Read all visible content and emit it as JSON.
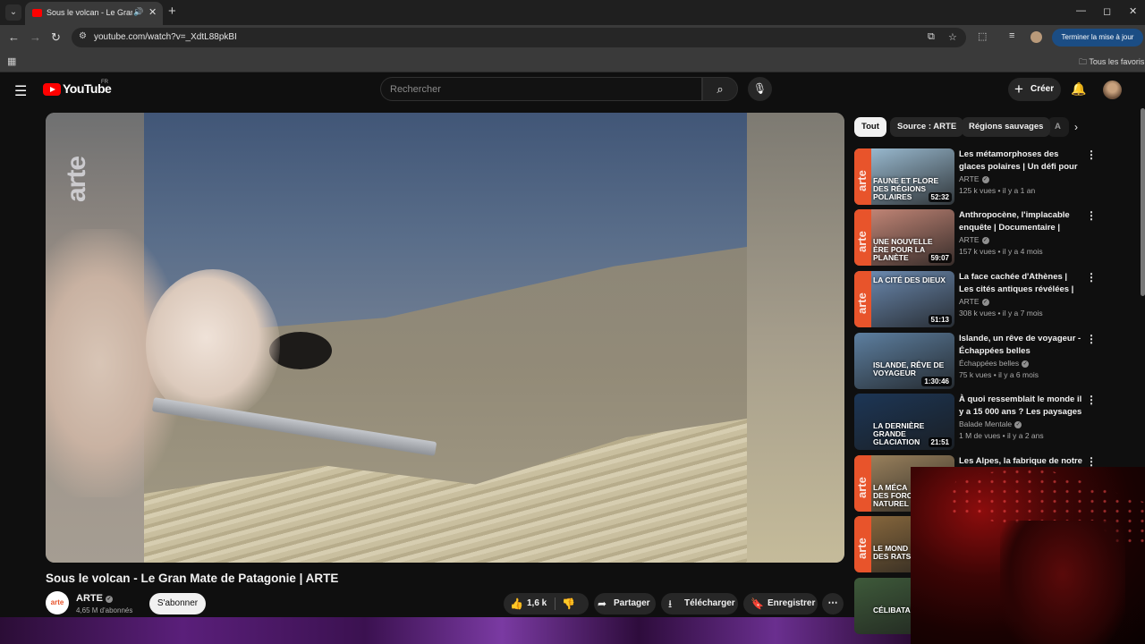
{
  "browser": {
    "tab_title": "Sous le volcan - Le Gran Mate",
    "new_tab": "+",
    "url": "youtube.com/watch?v=_XdtL88pkBI",
    "update_button": "Terminer la mise à jour",
    "bookmarks_folder": "Tous les favoris",
    "window_min": "—",
    "window_max": "◻",
    "window_close": "✕"
  },
  "header": {
    "logo": "YouTube",
    "country": "FR",
    "search_placeholder": "Rechercher",
    "create_label": "Créer"
  },
  "video": {
    "watermark": "arte",
    "title": "Sous le volcan - Le Gran Mate de Patagonie | ARTE",
    "channel": "ARTE",
    "channel_avatar_text": "arte",
    "subscribers": "4,65 M d'abonnés",
    "subscribe_label": "S'abonner",
    "likes": "1,6 k",
    "share_label": "Partager",
    "download_label": "Télécharger",
    "save_label": "Enregistrer"
  },
  "chips": [
    {
      "label": "Tout",
      "active": true
    },
    {
      "label": "Source : ARTE"
    },
    {
      "label": "Régions sauvages"
    },
    {
      "label": "A"
    }
  ],
  "sidebar": {
    "items": [
      {
        "title": "Les métamorphoses des glaces polaires | Un défi pour les ...",
        "channel": "ARTE",
        "meta": "125 k vues • il y a 1 an",
        "duration": "52:32",
        "caption": "FAUNE ET FLORE DES RÉGIONS POLAIRES",
        "thumb_bg": "#9fc1d8"
      },
      {
        "title": "Anthropocène, l'implacable enquête | Documentaire | ARTE",
        "channel": "ARTE",
        "meta": "157 k vues • il y a 4 mois",
        "duration": "59:07",
        "caption": "UNE NOUVELLE ÈRE POUR LA PLANÈTE",
        "thumb_bg": "#c98a7a"
      },
      {
        "title": "La face cachée d'Athènes | Les cités antiques révélées | ARTE",
        "channel": "ARTE",
        "meta": "308 k vues • il y a 7 mois",
        "duration": "51:13",
        "caption": "LA CITÉ DES DIEUX",
        "thumb_bg": "#6f8fb7"
      },
      {
        "title": "Islande, un rêve de voyageur - Échappées belles",
        "channel": "Échappées belles",
        "meta": "75 k vues • il y a 6 mois",
        "duration": "1:30:46",
        "caption": "ISLANDE, RÊVE DE VOYAGEUR",
        "thumb_bg": "#5d7fa0"
      },
      {
        "title": "À quoi ressemblait le monde il y a 15 000 ans ? Les paysages ...",
        "channel": "Balade Mentale",
        "meta": "1 M de vues • il y a 2 ans",
        "duration": "21:51",
        "caption": "LA DERNIÈRE GRANDE GLACIATION",
        "thumb_bg": "#1c3656"
      },
      {
        "title": "Les Alpes, la fabrique de notre",
        "channel": "",
        "meta": "",
        "duration": "",
        "caption": "LA MÉCA DES FORC NATUREL",
        "thumb_bg": "#a08660"
      },
      {
        "title": "",
        "channel": "",
        "meta": "",
        "duration": "",
        "caption": "LE MOND DES RATS",
        "thumb_bg": "#8b6a3e"
      },
      {
        "title": "",
        "channel": "",
        "meta": "",
        "duration": "",
        "caption": "CÉLIBATAIR",
        "thumb_bg": "#3e5a3a"
      }
    ]
  },
  "colors": {
    "accent": "#ff0000",
    "arte_orange": "#e8542b",
    "update_blue": "#1b4d84"
  }
}
